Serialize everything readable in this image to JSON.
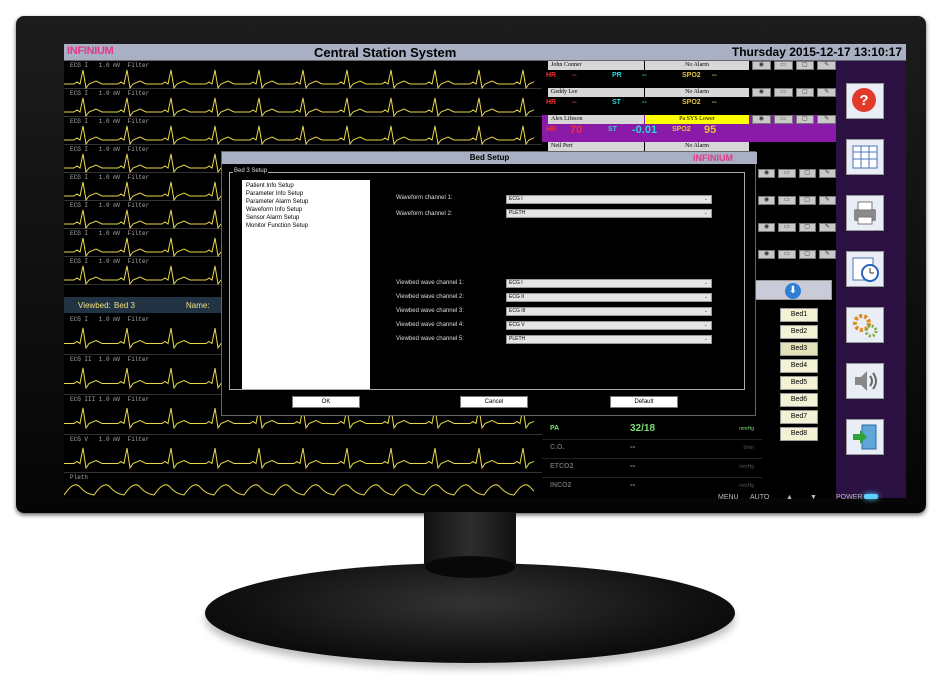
{
  "app": {
    "logo": "INFINIUM",
    "title": "Central Station System",
    "datetime": "Thursday 2015-12-17 13:10:17"
  },
  "waves": [
    {
      "label": "ECG I   1.0 mV  Filter"
    },
    {
      "label": "ECG I   1.0 mV  Filter"
    },
    {
      "label": "ECG I   1.0 mV  Filter"
    },
    {
      "label": "ECG I   1.0 mV  Filter"
    },
    {
      "label": "ECG I   1.0 mV  Filter"
    },
    {
      "label": "ECG I   1.0 mV  Filter"
    },
    {
      "label": "ECG I   1.0 mV  Filter"
    },
    {
      "label": "ECG I   1.0 mV  Filter"
    }
  ],
  "viewbed": {
    "label": "Viewbed:",
    "bed": "Bed 3",
    "name_label": "Name:"
  },
  "lower_waves": [
    {
      "label": "ECG I   1.0 mV  Filter"
    },
    {
      "label": "ECG II  1.0 mV  Filter"
    },
    {
      "label": "ECG III 1.0 mV  Filter"
    },
    {
      "label": "ECG V   1.0 mV  Filter"
    },
    {
      "label": "Pleth"
    }
  ],
  "patients": [
    {
      "name": "John Conner",
      "alarm": "No Alarm",
      "vitals": [
        "HR",
        "--",
        "PR",
        "--",
        "SPO2",
        "--"
      ]
    },
    {
      "name": "Geddy Lee",
      "alarm": "No Alarm",
      "vitals": [
        "HR",
        "--",
        "ST",
        "--",
        "SPO2",
        "--"
      ]
    },
    {
      "name": "Alex Lifeson",
      "alarm": "Pa SYS Lower",
      "vitals": [
        "HR",
        "70",
        "ST",
        "-0.01",
        "SPO2",
        "95"
      ]
    },
    {
      "name": "Neil Pert",
      "alarm": "No Alarm",
      "vitals": []
    }
  ],
  "beds": [
    "Bed1",
    "Bed2",
    "Bed3",
    "Bed4",
    "Bed5",
    "Bed6",
    "Bed7",
    "Bed8"
  ],
  "bed_selected_index": 2,
  "params": [
    {
      "label": "PA",
      "value": "32/18",
      "unit": "mmHg"
    },
    {
      "label": "C.O.",
      "value": "--",
      "unit": "l/min"
    },
    {
      "label": "ETCO2",
      "value": "--",
      "unit": "mmHg"
    },
    {
      "label": "INCO2",
      "value": "--",
      "unit": "mmHg"
    }
  ],
  "dialog": {
    "title": "Bed Setup",
    "logo": "INFINIUM",
    "group_label": "Bed 3 Setup",
    "tree": [
      "Patient Info Setup",
      "Parameter Info Setup",
      "Parameter Alarm Setup",
      "Waveform Info Setup",
      "Sensor Alarm Setup",
      "Monitor Function Setup"
    ],
    "fields": [
      {
        "label": "Waveform channel 1:",
        "value": "ECG I"
      },
      {
        "label": "Waveform channel 2:",
        "value": "PLETH"
      },
      {
        "label": "Viewbed wave channel 1:",
        "value": "ECG I"
      },
      {
        "label": "Viewbed wave channel 2:",
        "value": "ECG II"
      },
      {
        "label": "Viewbed wave channel 3:",
        "value": "ECG III"
      },
      {
        "label": "Viewbed wave channel 4:",
        "value": "ECG V"
      },
      {
        "label": "Viewbed wave channel 5:",
        "value": "PLETH"
      }
    ],
    "buttons": {
      "ok": "OK",
      "cancel": "Cancel",
      "default": "Default"
    }
  },
  "sidebar_icons": [
    "help-icon",
    "table-icon",
    "printer-icon",
    "clock-icon",
    "settings-icon",
    "speaker-icon",
    "exit-icon"
  ],
  "hardware": {
    "menu": "MENU",
    "auto": "AUTO",
    "up": "▲",
    "down": "▼",
    "power": "POWER"
  },
  "colors": {
    "accent": "#e03a8c",
    "title_bar": "#a9b0c4",
    "wave": "#e8d94a",
    "alarm_yellow": "#ffff00",
    "alarm_row": "#8a1aa8",
    "param_green": "#7fda77"
  }
}
